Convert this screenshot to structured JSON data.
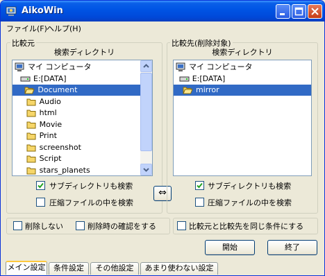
{
  "window": {
    "title": "AikoWin"
  },
  "menu": {
    "file": "ファイル(F)",
    "help": "ヘルプ(H)"
  },
  "source": {
    "group_label": "比較元",
    "dir_label": "検索ディレクトリ",
    "tree": [
      {
        "label": "マイ コンピュータ",
        "icon": "computer-icon"
      },
      {
        "label": "E:[DATA]",
        "icon": "drive-icon"
      },
      {
        "label": "Document",
        "icon": "open-folder-icon",
        "selected": true
      },
      {
        "label": "Audio",
        "icon": "folder-icon"
      },
      {
        "label": "html",
        "icon": "folder-icon"
      },
      {
        "label": "Movie",
        "icon": "folder-icon"
      },
      {
        "label": "Print",
        "icon": "folder-icon"
      },
      {
        "label": "screenshot",
        "icon": "folder-icon"
      },
      {
        "label": "Script",
        "icon": "folder-icon"
      },
      {
        "label": "stars_planets",
        "icon": "folder-icon"
      }
    ],
    "subdir_label": "サブディレクトリも検索",
    "subdir_checked": true,
    "archive_label": "圧縮ファイルの中を検索",
    "archive_checked": false
  },
  "target": {
    "group_label": "比較先(削除対象)",
    "dir_label": "検索ディレクトリ",
    "tree": [
      {
        "label": "マイ コンピュータ",
        "icon": "computer-icon"
      },
      {
        "label": "E:[DATA]",
        "icon": "drive-icon"
      },
      {
        "label": "mirror",
        "icon": "open-folder-icon",
        "selected": true
      }
    ],
    "subdir_label": "サブディレクトリも検索",
    "subdir_checked": true,
    "archive_label": "圧縮ファイルの中を検索",
    "archive_checked": false
  },
  "swap_symbol": "⇔",
  "options": {
    "no_delete": "削除しない",
    "confirm_delete": "削除時の確認をする",
    "same_condition": "比較元と比較先を同じ条件にする"
  },
  "buttons": {
    "start": "開始",
    "exit": "終了"
  },
  "tabs": [
    "メイン設定",
    "条件設定",
    "その他設定",
    "あまり使わない設定"
  ]
}
